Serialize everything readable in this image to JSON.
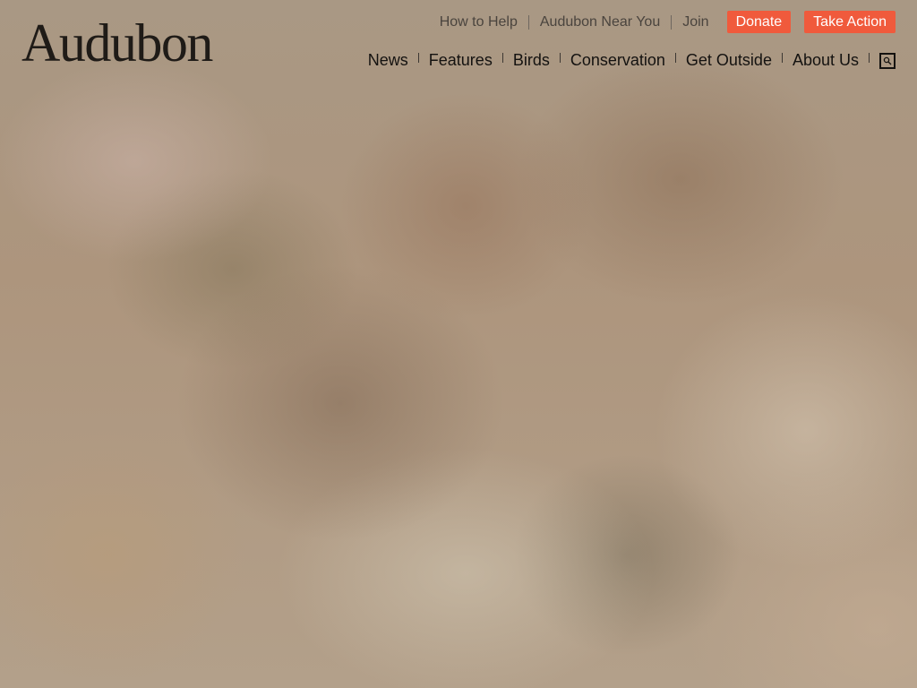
{
  "brand": {
    "logo_text": "Audubon"
  },
  "utility_nav": {
    "links": [
      "How to Help",
      "Audubon Near You",
      "Join"
    ],
    "donate_label": "Donate",
    "take_action_label": "Take Action"
  },
  "main_nav": {
    "items": [
      "News",
      "Features",
      "Birds",
      "Conservation",
      "Get Outside",
      "About Us"
    ],
    "search_icon": "search-icon"
  },
  "colors": {
    "cta_background": "#f05a3c",
    "cta_text": "#ffffff",
    "nav_text": "#141210",
    "utility_text": "#4a443e"
  }
}
